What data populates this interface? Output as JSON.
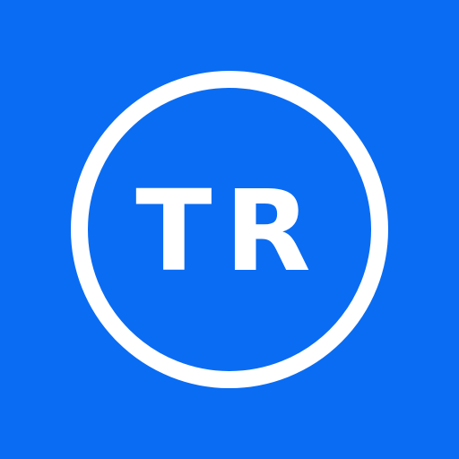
{
  "app_icon": {
    "monogram": "TR",
    "background_color": "#0a6cf3",
    "foreground_color": "#ffffff"
  }
}
